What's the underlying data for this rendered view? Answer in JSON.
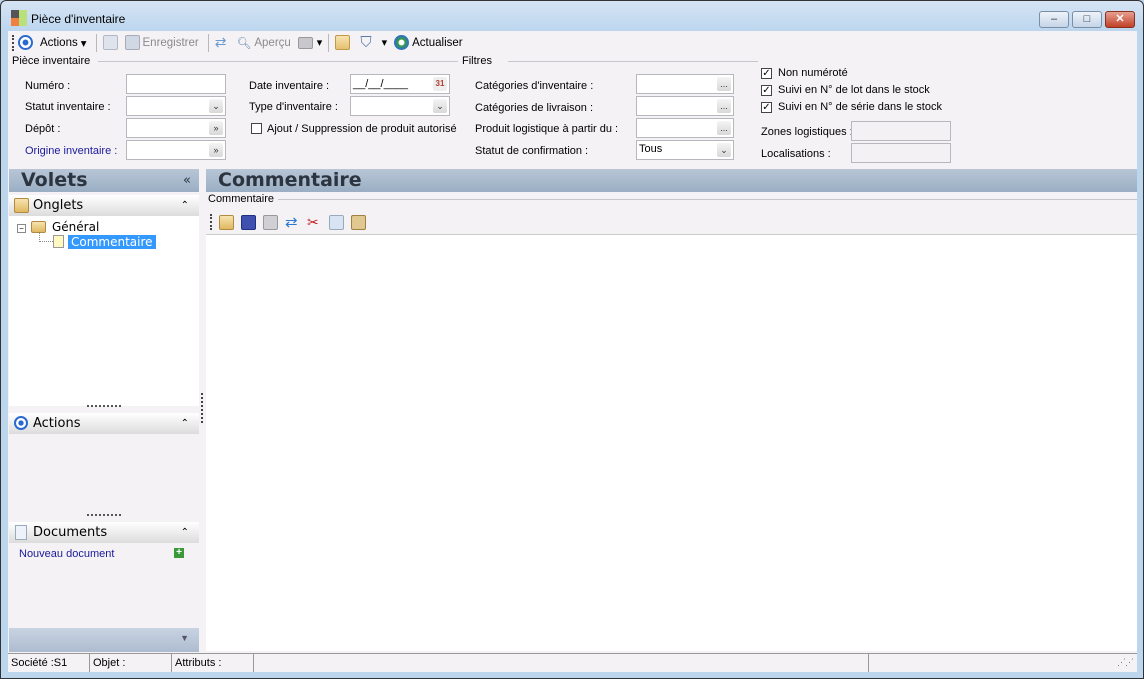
{
  "window": {
    "title": "Pièce d'inventaire",
    "minimize": "–",
    "maximize": "□",
    "close": "✕"
  },
  "toolbar": {
    "actions": "Actions",
    "enregistrer": "Enregistrer",
    "apercu": "Aperçu",
    "actualiser": "Actualiser"
  },
  "piece": {
    "group": "Pièce inventaire",
    "numero": "Numéro :",
    "statut": "Statut inventaire :",
    "depot": "Dépôt :",
    "origine": "Origine inventaire :",
    "date": "Date inventaire :",
    "date_value": "__/__/____",
    "type": "Type d'inventaire :",
    "ajout": "Ajout / Suppression de produit autorisé",
    "calendar": "31"
  },
  "filtres": {
    "group": "Filtres",
    "cat_inv": "Catégories d'inventaire :",
    "cat_liv": "Catégories de livraison :",
    "produit": "Produit logistique à partir du  :",
    "statut_conf": "Statut de confirmation  :",
    "statut_conf_value": "Tous",
    "non_numerote": "Non numéroté",
    "suivi_lot": "Suivi en N° de lot dans le stock",
    "suivi_serie": "Suivi en N° de série dans le stock",
    "zones": "Zones logistiques :",
    "localisations": "Localisations :",
    "ellipsis": "..."
  },
  "volets": {
    "title": "Volets",
    "onglets": "Onglets",
    "general": "Général",
    "commentaire": "Commentaire",
    "actions": "Actions",
    "documents": "Documents",
    "nouveau_document": "Nouveau document"
  },
  "main": {
    "title": "Commentaire",
    "group": "Commentaire"
  },
  "status": {
    "societe": "Société :S1",
    "objet": "Objet :",
    "attributs": "Attributs :"
  },
  "colors": {
    "accent": "#3399ff",
    "link": "#1a1a9a"
  }
}
